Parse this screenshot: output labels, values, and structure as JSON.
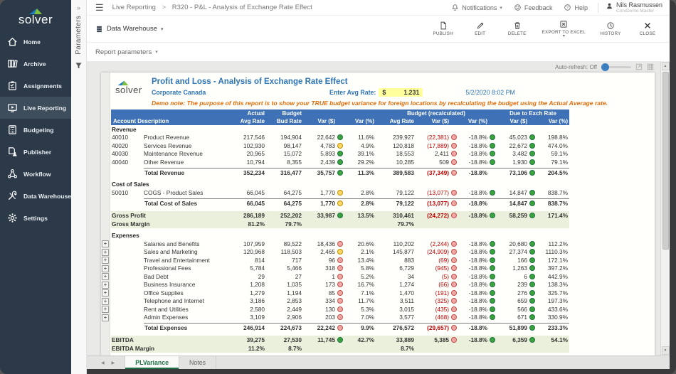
{
  "sidebar": {
    "logo_text": "solver",
    "items": [
      {
        "label": "Home",
        "icon": "home-icon",
        "active": false
      },
      {
        "label": "Archive",
        "icon": "archive-icon",
        "active": false
      },
      {
        "label": "Assignments",
        "icon": "assignments-icon",
        "active": false
      },
      {
        "label": "Live Reporting",
        "icon": "live-reporting-icon",
        "active": true
      },
      {
        "label": "Budgeting",
        "icon": "budgeting-icon",
        "active": false
      },
      {
        "label": "Publisher",
        "icon": "publisher-icon",
        "active": false
      },
      {
        "label": "Workflow",
        "icon": "workflow-icon",
        "active": false
      },
      {
        "label": "Data Warehouse",
        "icon": "data-warehouse-icon",
        "active": false
      },
      {
        "label": "Settings",
        "icon": "settings-icon",
        "active": false
      }
    ]
  },
  "parameters_panel": {
    "label": "Parameters",
    "chevron": "»"
  },
  "topbar": {
    "breadcrumb": {
      "section": "Live Reporting",
      "separator": ">",
      "page": "R320 - P&L - Analysis of Exchange Rate Effect"
    },
    "menu": {
      "notifications": "Notifications",
      "feedback": "Feedback",
      "help": "Help"
    },
    "user": {
      "name": "Nils Rasmussen",
      "role": "CoreDemo Master"
    }
  },
  "actionbar": {
    "source_label": "Data Warehouse",
    "buttons": [
      {
        "label": "PUBLISH",
        "icon": "publish-icon",
        "caret": false
      },
      {
        "label": "EDIT",
        "icon": "edit-icon",
        "caret": false
      },
      {
        "label": "DELETE",
        "icon": "delete-icon",
        "caret": false
      },
      {
        "label": "EXPORT TO EXCEL",
        "icon": "export-excel-icon",
        "caret": true
      },
      {
        "label": "HISTORY",
        "icon": "history-icon",
        "caret": false
      },
      {
        "label": "CLOSE",
        "icon": "close-icon",
        "caret": false
      }
    ]
  },
  "paramsbar": {
    "label": "Report parameters"
  },
  "autorefresh": {
    "label": "Auto-refresh: Off"
  },
  "report": {
    "logo_text": "solver",
    "title": "Profit and Loss - Analysis of Exchange Rate Effect",
    "subtitle": "Corporate Canada",
    "rate_label": "Enter Avg Rate:",
    "rate_currency": "$",
    "rate_value": "1.231",
    "timestamp": "5/2/2020 8:02 PM",
    "demo_note": "Demo note: The purpose of this report is to show your TRUE budget variance for foreign locations by recalculating the budget using the Actual Average rate.",
    "table": {
      "groups": {
        "actual": "Actual",
        "budget": "Budget",
        "recalculated": "Budget (recalculated)",
        "exchange": "Due to Exch Rate"
      },
      "account_header": "Account Description",
      "columns": [
        "Avg Rate",
        "Bud Rate",
        "Var ($)",
        "Var (%)",
        "Avg Rate",
        "Var ($)",
        "Var (%)",
        "Var ($)",
        "Var (%)"
      ],
      "rows": [
        {
          "type": "section",
          "label": "Revenue"
        },
        {
          "type": "detail",
          "code": "40010",
          "desc": "Product Revenue",
          "cells": [
            "217,546",
            "194,904",
            "22,642",
            "11.6%",
            "239,927",
            "(22,381)",
            "-18.8%",
            "45,023",
            "198.8%"
          ],
          "dots": [
            "g",
            "r",
            "g",
            "g"
          ]
        },
        {
          "type": "detail",
          "code": "40020",
          "desc": "Services Revenue",
          "cells": [
            "102,930",
            "98,147",
            "4,783",
            "4.9%",
            "120,818",
            "(17,889)",
            "-18.8%",
            "22,672",
            "474.0%"
          ],
          "dots": [
            "y",
            "r",
            "g",
            "g"
          ]
        },
        {
          "type": "detail",
          "code": "40030",
          "desc": "Maintenance Revenue",
          "cells": [
            "20,965",
            "15,072",
            "5,893",
            "39.1%",
            "18,553",
            "2,411",
            "-18.8%",
            "3,482",
            "59.1%"
          ],
          "dots": [
            "g",
            "r",
            "g",
            "g"
          ]
        },
        {
          "type": "detail",
          "code": "40040",
          "desc": "Other Revenue",
          "cells": [
            "10,794",
            "8,355",
            "2,439",
            "29.2%",
            "10,285",
            "509",
            "-18.8%",
            "1,930",
            "79.1%"
          ],
          "dots": [
            "g",
            "r",
            "g",
            "g"
          ]
        },
        {
          "type": "total",
          "desc": "Total Revenue",
          "cells": [
            "352,234",
            "316,477",
            "35,757",
            "11.3%",
            "389,583",
            "(37,349)",
            "-18.8%",
            "73,106",
            "204.5%"
          ],
          "dots": [
            "g",
            "r",
            null,
            "g"
          ]
        },
        {
          "type": "spacer"
        },
        {
          "type": "section",
          "label": "Cost of Sales"
        },
        {
          "type": "detail",
          "code": "50010",
          "desc": "COGS - Product Sales",
          "cells": [
            "66,045",
            "64,275",
            "1,770",
            "2.8%",
            "79,122",
            "(13,077)",
            "-18.8%",
            "14,847",
            "838.7%"
          ],
          "dots": [
            "y",
            "r",
            "g",
            "g"
          ]
        },
        {
          "type": "total",
          "desc": "Total Cost of Sales",
          "cells": [
            "66,045",
            "64,275",
            "1,770",
            "2.8%",
            "79,122",
            "(13,077)",
            "-18.8%",
            "14,847",
            "838.7%"
          ],
          "dots": [
            "y",
            "r",
            null,
            "g"
          ]
        },
        {
          "type": "spacer"
        },
        {
          "type": "band",
          "label": "Gross Profit",
          "cells": [
            "286,189",
            "252,202",
            "33,987",
            "13.5%",
            "310,461",
            "(24,272)",
            "-18.8%",
            "58,259",
            "171.4%"
          ],
          "dots": [
            "g",
            "r",
            "g",
            "g"
          ]
        },
        {
          "type": "band",
          "label": "Gross Margin",
          "cells": [
            "81.2%",
            "79.7%",
            "",
            "",
            "79.7%",
            "",
            "",
            "",
            ""
          ],
          "dots": [
            null,
            null,
            null,
            null
          ]
        },
        {
          "type": "spacer"
        },
        {
          "type": "section",
          "label": "Expenses"
        },
        {
          "type": "detail",
          "code": "",
          "desc": "Salaries and Benefits",
          "cells": [
            "107,959",
            "89,522",
            "18,436",
            "20.6%",
            "110,202",
            "(2,244)",
            "-18.8%",
            "20,680",
            "112.2%"
          ],
          "dots": [
            "r",
            "r",
            "g",
            "g"
          ],
          "plus": true
        },
        {
          "type": "detail",
          "code": "",
          "desc": "Sales and Marketing",
          "cells": [
            "120,968",
            "118,503",
            "2,465",
            "2.1%",
            "145,877",
            "(24,909)",
            "-18.8%",
            "27,374",
            "1110.3%"
          ],
          "dots": [
            "y",
            "r",
            "g",
            "g"
          ],
          "plus": true
        },
        {
          "type": "detail",
          "code": "",
          "desc": "Travel and Entertainment",
          "cells": [
            "814",
            "717",
            "96",
            "13.4%",
            "883",
            "(69)",
            "-18.8%",
            "166",
            "172.1%"
          ],
          "dots": [
            "r",
            "r",
            "g",
            "g"
          ],
          "plus": true
        },
        {
          "type": "detail",
          "code": "",
          "desc": "Professional Fees",
          "cells": [
            "5,784",
            "5,466",
            "318",
            "5.8%",
            "6,729",
            "(945)",
            "-18.8%",
            "1,263",
            "397.2%"
          ],
          "dots": [
            "r",
            "r",
            "g",
            "g"
          ],
          "plus": true
        },
        {
          "type": "detail",
          "code": "",
          "desc": "Bad Debt",
          "cells": [
            "29",
            "27",
            "1",
            "5.2%",
            "34",
            "(5)",
            "-18.8%",
            "6",
            "442.9%"
          ],
          "dots": [
            "r",
            "r",
            "g",
            "g"
          ],
          "plus": true
        },
        {
          "type": "detail",
          "code": "",
          "desc": "Business Insurance",
          "cells": [
            "1,208",
            "1,035",
            "173",
            "16.7%",
            "1,274",
            "(66)",
            "-18.8%",
            "239",
            "138.3%"
          ],
          "dots": [
            "r",
            "r",
            "g",
            "g"
          ],
          "plus": true
        },
        {
          "type": "detail",
          "code": "",
          "desc": "Office Supplies",
          "cells": [
            "1,279",
            "1,194",
            "85",
            "7.1%",
            "1,470",
            "(191)",
            "-18.8%",
            "276",
            "325.7%"
          ],
          "dots": [
            "r",
            "r",
            "g",
            "g"
          ],
          "plus": true
        },
        {
          "type": "detail",
          "code": "",
          "desc": "Telephone and Internet",
          "cells": [
            "3,186",
            "2,853",
            "334",
            "11.7%",
            "3,511",
            "(325)",
            "-18.8%",
            "659",
            "197.3%"
          ],
          "dots": [
            "r",
            "r",
            "g",
            "g"
          ],
          "plus": true
        },
        {
          "type": "detail",
          "code": "",
          "desc": "Rent and Utilities",
          "cells": [
            "2,580",
            "2,449",
            "130",
            "5.3%",
            "3,015",
            "(435)",
            "-18.8%",
            "566",
            "433.6%"
          ],
          "dots": [
            "r",
            "r",
            "g",
            "g"
          ],
          "plus": true
        },
        {
          "type": "detail",
          "code": "",
          "desc": "Admin Expenses",
          "cells": [
            "3,109",
            "2,906",
            "203",
            "7.0%",
            "3,577",
            "(468)",
            "-18.8%",
            "671",
            "330.9%"
          ],
          "dots": [
            "r",
            "r",
            "g",
            "g"
          ],
          "plus": true
        },
        {
          "type": "total",
          "desc": "Total Expenses",
          "cells": [
            "246,914",
            "224,673",
            "22,242",
            "9.9%",
            "276,572",
            "(29,657)",
            "-18.8%",
            "51,899",
            "233.3%"
          ],
          "dots": [
            "r",
            "r",
            null,
            "g"
          ]
        },
        {
          "type": "spacer"
        },
        {
          "type": "band",
          "label": "EBITDA",
          "cells": [
            "39,275",
            "27,530",
            "11,745",
            "42.7%",
            "33,889",
            "5,385",
            "-18.8%",
            "6,359",
            "54.1%"
          ],
          "dots": [
            "g",
            "r",
            "g",
            "g"
          ]
        },
        {
          "type": "band",
          "label": "EBITDA Margin",
          "cells": [
            "11.2%",
            "8.7%",
            "",
            "",
            "8.7%",
            "",
            "",
            "",
            ""
          ],
          "dots": [
            null,
            null,
            null,
            null
          ]
        }
      ]
    },
    "tabs": [
      {
        "label": "PLVariance",
        "active": true
      },
      {
        "label": "Notes",
        "active": false
      }
    ]
  },
  "colors": {
    "sidebar_bg": "#2b3948",
    "sidebar_active_bg": "#3e4d5b",
    "table_header_blue": "#3e71b6",
    "band_green": "#eaf0db",
    "note_orange": "#e36c09",
    "title_blue": "#2e74b5",
    "negative_red": "#c00000",
    "rate_highlight_yellow": "#ffff9e",
    "tab_active_green": "#1e7145",
    "dot_green": "#3ba33b",
    "dot_red": "#f0a8a5",
    "dot_yellow": "#ffd965",
    "slider_blue": "#3c7fc0"
  }
}
